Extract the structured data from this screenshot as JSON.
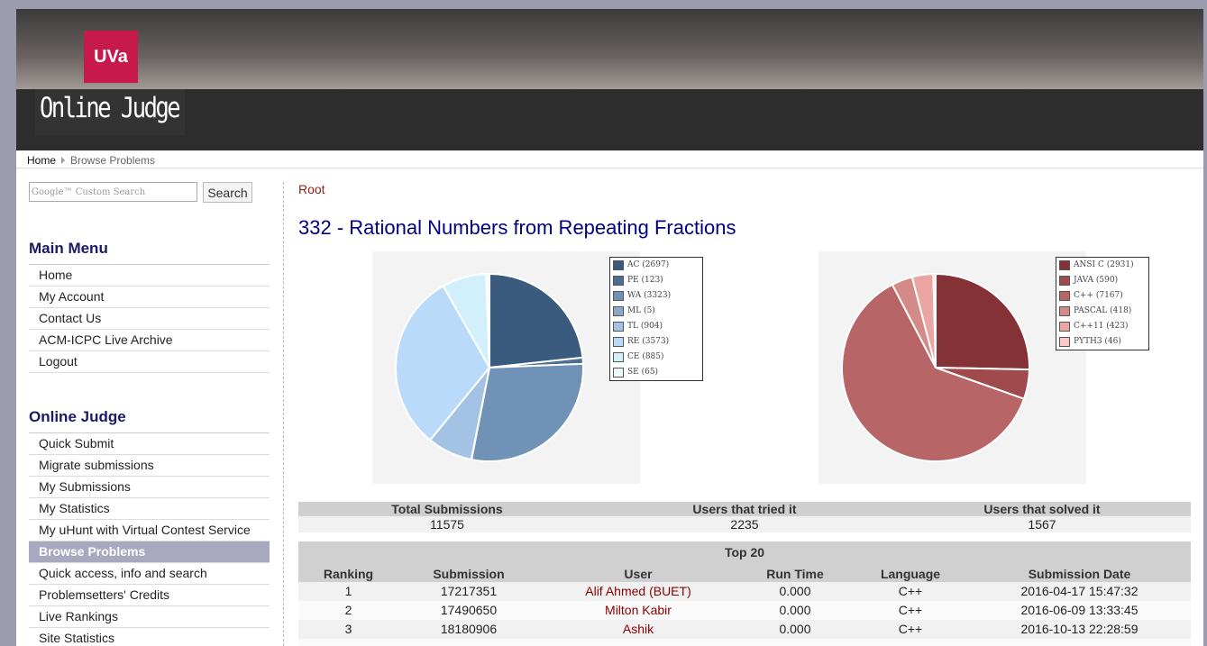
{
  "header": {
    "logo": "UVa",
    "site_name": "Online Judge"
  },
  "breadcrumb": {
    "home": "Home",
    "current": "Browse Problems"
  },
  "search": {
    "placeholder": "Google™ Custom Search",
    "button": "Search"
  },
  "main_menu": {
    "title": "Main Menu",
    "items": [
      "Home",
      "My Account",
      "Contact Us",
      "ACM-ICPC Live Archive",
      "Logout"
    ]
  },
  "online_judge_menu": {
    "title": "Online Judge",
    "items": [
      "Quick Submit",
      "Migrate submissions",
      "My Submissions",
      "My Statistics",
      "My uHunt with Virtual Contest Service",
      "Browse Problems",
      "Quick access, info and search",
      "Problemsetters' Credits",
      "Live Rankings",
      "Site Statistics"
    ],
    "active": "Browse Problems"
  },
  "content": {
    "root_link": "Root",
    "title": "332 - Rational Numbers from Repeating Fractions"
  },
  "chart_data": [
    {
      "type": "pie",
      "title": "",
      "labels": [
        "AC (2697)",
        "PE (123)",
        "WA (3323)",
        "ML (5)",
        "TL (904)",
        "RE (3573)",
        "CE (885)",
        "SE (65)"
      ],
      "values": [
        2697,
        123,
        3323,
        5,
        904,
        3573,
        885,
        65
      ],
      "colors": [
        "#3a5a7e",
        "#4d6e93",
        "#6f92b6",
        "#8aa8c8",
        "#a4c2e4",
        "#b9daf9",
        "#d2f0fb",
        "#eefbfd"
      ],
      "legend": "right"
    },
    {
      "type": "pie",
      "title": "",
      "labels": [
        "ANSI C (2931)",
        "JAVA (590)",
        "C++ (7167)",
        "PASCAL (418)",
        "C++11 (423)",
        "PYTH3 (46)"
      ],
      "values": [
        2931,
        590,
        7167,
        418,
        423,
        46
      ],
      "colors": [
        "#843236",
        "#a14a4e",
        "#b86567",
        "#d48a88",
        "#eba6a3",
        "#fcc8c6"
      ],
      "legend": "right"
    }
  ],
  "stats": {
    "headers": [
      "Total Submissions",
      "Users that tried it",
      "Users that solved it"
    ],
    "values": [
      "11575",
      "2235",
      "1567"
    ]
  },
  "top20": {
    "title": "Top 20",
    "headers": [
      "Ranking",
      "Submission",
      "User",
      "Run Time",
      "Language",
      "Submission Date"
    ],
    "rows": [
      [
        "1",
        "17217351",
        "Alif Ahmed (BUET)",
        "0.000",
        "C++",
        "2016-04-17 15:47:32"
      ],
      [
        "2",
        "17490650",
        "Milton Kabir",
        "0.000",
        "C++",
        "2016-06-09 13:33:45"
      ],
      [
        "3",
        "18180906",
        "Ashik",
        "0.000",
        "C++",
        "2016-10-13 22:28:59"
      ]
    ]
  }
}
